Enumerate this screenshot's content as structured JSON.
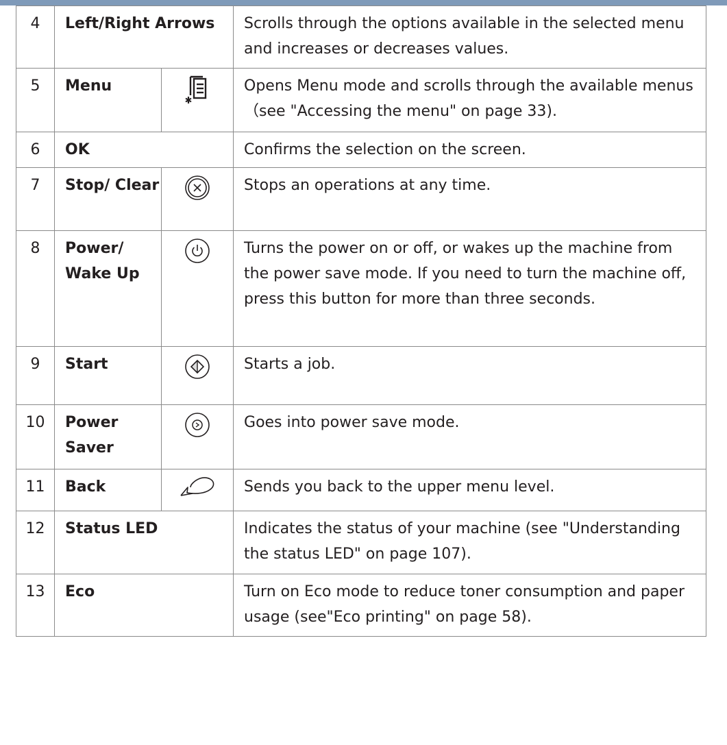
{
  "colors": {
    "header_bar": "#7f9ab9",
    "border": "#8a8a8a",
    "text": "#231f20"
  },
  "rows": [
    {
      "num": "4",
      "name": "Left/Right Arrows",
      "icon": null,
      "desc": "Scrolls through the options available in the selected menu and increases or decreases values."
    },
    {
      "num": "5",
      "name": "Menu",
      "icon": "menu-icon",
      "desc": "Opens Menu mode and scrolls through the available menus（see \"Accessing the menu\" on page 33)."
    },
    {
      "num": "6",
      "name": "OK",
      "icon": null,
      "desc": "Confirms the selection on the screen."
    },
    {
      "num": "7",
      "name": "Stop/ Clear",
      "icon": "stop-clear-icon",
      "desc": "Stops an operations at any time."
    },
    {
      "num": "8",
      "name": "Power/ Wake Up",
      "icon": "power-icon",
      "desc": "Turns the power on or off, or wakes up the machine from the power save mode. If you need to turn the machine off, press this button for more than three seconds."
    },
    {
      "num": "9",
      "name": "Start",
      "icon": "start-icon",
      "desc": "Starts a job."
    },
    {
      "num": "10",
      "name": "Power Saver",
      "icon": "power-saver-icon",
      "desc": "Goes into power save mode."
    },
    {
      "num": "11",
      "name": "Back",
      "icon": "back-icon",
      "desc": "Sends you back to the upper menu level."
    },
    {
      "num": "12",
      "name": "Status LED",
      "icon": null,
      "desc": "Indicates the status of your machine (see \"Understanding the status LED\" on page 107)."
    },
    {
      "num": "13",
      "name": "Eco",
      "icon": null,
      "desc": "Turn on Eco mode to reduce toner consumption and paper usage (see\"Eco printing\" on page 58)."
    }
  ]
}
